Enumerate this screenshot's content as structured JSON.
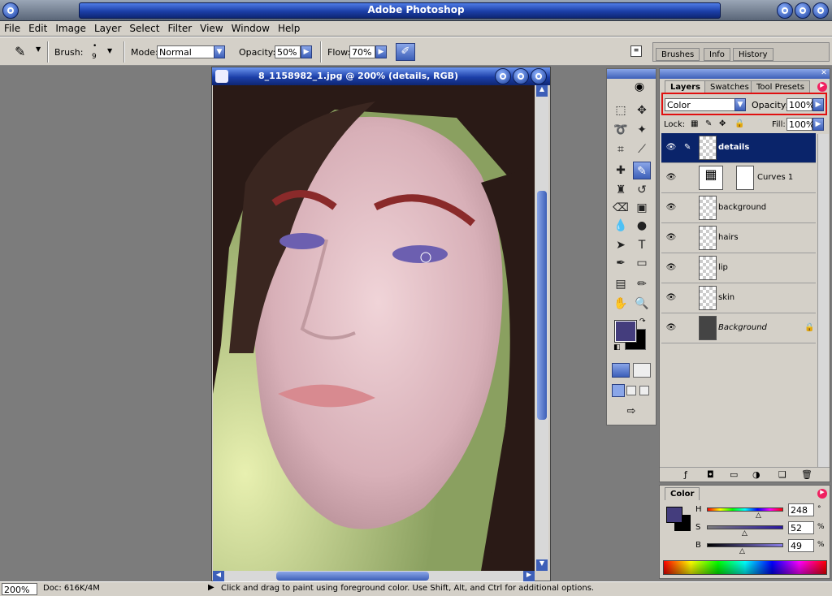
{
  "app": {
    "title": "Adobe Photoshop"
  },
  "menu": [
    "File",
    "Edit",
    "Image",
    "Layer",
    "Select",
    "Filter",
    "View",
    "Window",
    "Help"
  ],
  "options": {
    "brush_label": "Brush:",
    "brush_size": "9",
    "mode_label": "Mode:",
    "mode_value": "Normal",
    "opacity_label": "Opacity:",
    "opacity_value": "50%",
    "flow_label": "Flow:",
    "flow_value": "70%",
    "palette_tabs": [
      "Brushes",
      "Info",
      "History"
    ]
  },
  "document": {
    "title": "8_1158982_1.jpg @ 200% (details, RGB)"
  },
  "layers_panel": {
    "tabs": [
      "Layers",
      "Swatches",
      "Tool Presets"
    ],
    "blend_mode": "Color",
    "opacity_label": "Opacity:",
    "opacity_value": "100%",
    "lock_label": "Lock:",
    "fill_label": "Fill:",
    "fill_value": "100%",
    "layers": [
      "details",
      "Curves 1",
      "background",
      "hairs",
      "lip",
      "skin",
      "Background"
    ]
  },
  "color_panel": {
    "tab": "Color",
    "h_label": "H",
    "h_value": "248",
    "h_unit": "°",
    "s_label": "S",
    "s_value": "52",
    "s_unit": "%",
    "b_label": "B",
    "b_value": "49",
    "b_unit": "%",
    "foreground_color": "#443d7d",
    "highlight_color": "#e01010"
  },
  "status": {
    "zoom": "200%",
    "doc": "Doc: 616K/4M",
    "message": "Click and drag to paint using foreground color.  Use Shift, Alt, and Ctrl for additional options."
  }
}
